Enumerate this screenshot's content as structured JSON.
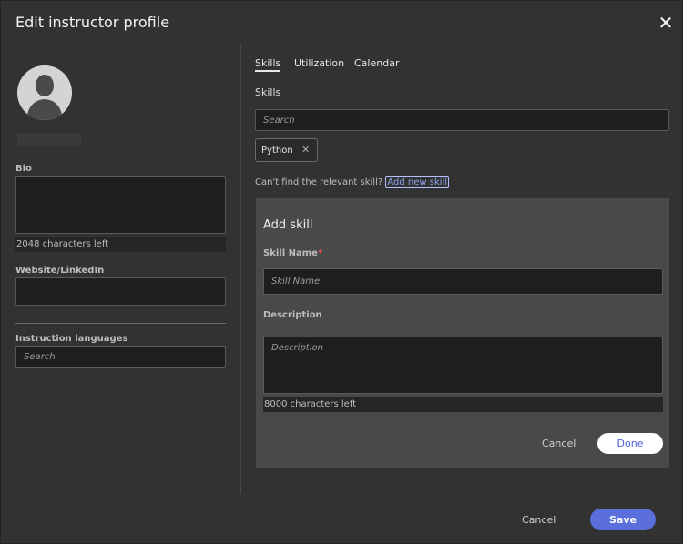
{
  "dialog": {
    "title": "Edit instructor profile",
    "close_glyph": "✕"
  },
  "profile": {
    "bio_label": "Bio",
    "bio_counter": "2048 characters left",
    "website_label": "Website/LinkedIn",
    "languages_label": "Instruction languages",
    "languages_placeholder": "Search"
  },
  "tabs": [
    {
      "label": "Skills",
      "active": true
    },
    {
      "label": "Utilization",
      "active": false
    },
    {
      "label": "Calendar",
      "active": false
    }
  ],
  "skills": {
    "section_label": "Skills",
    "search_placeholder": "Search",
    "chips": [
      {
        "label": "Python",
        "remove_glyph": "✕"
      }
    ],
    "hint_text": "Can't find the relevant skill?",
    "add_link": "Add new skill"
  },
  "add_skill": {
    "title": "Add skill",
    "name_label": "Skill Name",
    "required_mark": "*",
    "name_placeholder": "Skill Name",
    "description_label": "Description",
    "description_placeholder": "Description",
    "description_counter": "8000 characters left",
    "cancel_label": "Cancel",
    "done_label": "Done"
  },
  "footer": {
    "cancel_label": "Cancel",
    "save_label": "Save"
  },
  "colors": {
    "accent": "#5a6fdc",
    "link": "#8ea2f2",
    "required": "#e05050"
  }
}
